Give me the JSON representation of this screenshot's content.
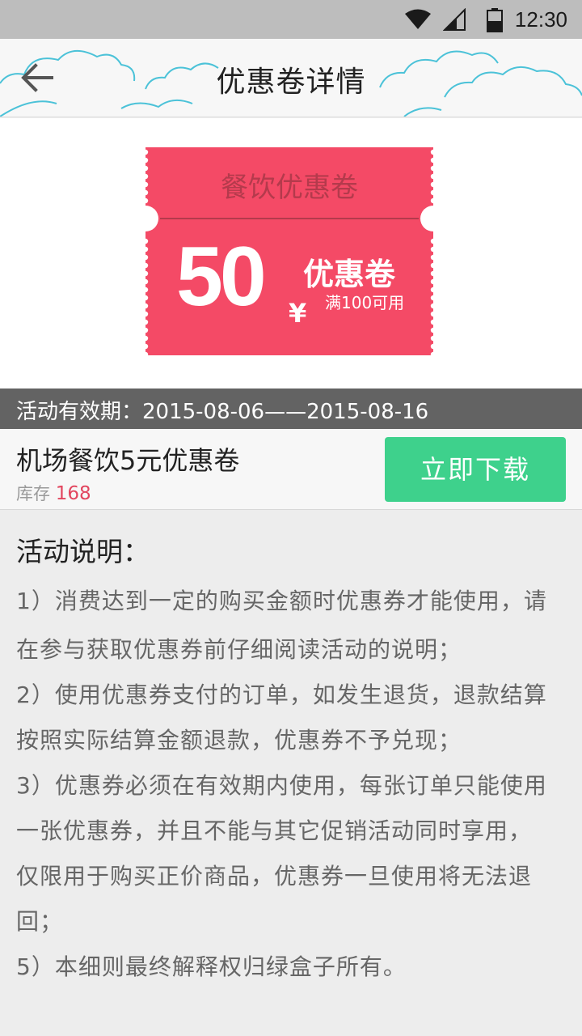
{
  "status_bar": {
    "time": "12:30",
    "icons": [
      "wifi-icon",
      "signal-icon",
      "battery-icon"
    ]
  },
  "header": {
    "title": "优惠卷详情",
    "back_icon": "arrow-left-icon"
  },
  "coupon": {
    "heading": "餐饮优惠卷",
    "amount": "50",
    "currency": "¥",
    "label": "优惠卷",
    "condition": "满100可用",
    "colors": {
      "body": "#f44a66",
      "heading": "#b43a4c"
    }
  },
  "validity": {
    "text": "活动有效期：2015-08-06——2015-08-16"
  },
  "item": {
    "name": "机场餐饮5元优惠卷",
    "stock_label": "库存",
    "stock_value": "168",
    "download_label": "立即下载",
    "colors": {
      "button": "#3ed18c",
      "stock": "#e2455e"
    }
  },
  "description": {
    "title": "活动说明：",
    "lines": [
      "1）消费达到一定的购买金额时优惠券才能使用，请",
      "在参与获取优惠券前仔细阅读活动的说明；",
      "2）使用优惠券支付的订单，如发生退货，退款结算",
      "按照实际结算金额退款，优惠券不予兑现；",
      "3）优惠券必须在有效期内使用，每张订单只能使用",
      "一张优惠券，并且不能与其它促销活动同时享用，",
      "仅限用于购买正价商品，优惠券一旦使用将无法退",
      "回；",
      "5）本细则最终解释权归绿盒子所有。"
    ]
  }
}
